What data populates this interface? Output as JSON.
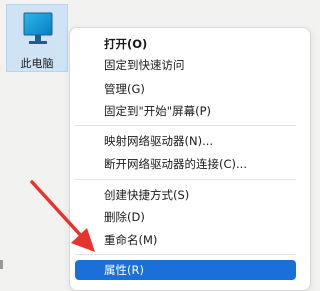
{
  "desktop": {
    "icon_label": "此电脑"
  },
  "menu": {
    "items": [
      {
        "label": "打开(O)"
      },
      {
        "label": "固定到快速访问"
      },
      {
        "label": "管理(G)"
      },
      {
        "label": "固定到\"开始\"屏幕(P)"
      },
      {
        "label": "映射网络驱动器(N)..."
      },
      {
        "label": "断开网络驱动器的连接(C)..."
      },
      {
        "label": "创建快捷方式(S)"
      },
      {
        "label": "删除(D)"
      },
      {
        "label": "重命名(M)"
      },
      {
        "label": "属性(R)"
      }
    ]
  },
  "colors": {
    "highlight": "#1a6fd8",
    "annotation_arrow": "#e8322d",
    "icon_selection": "#cfe3f5"
  },
  "icons": {
    "desktop_icon": "computer-monitor-icon",
    "annotation": "red-arrow-icon"
  }
}
